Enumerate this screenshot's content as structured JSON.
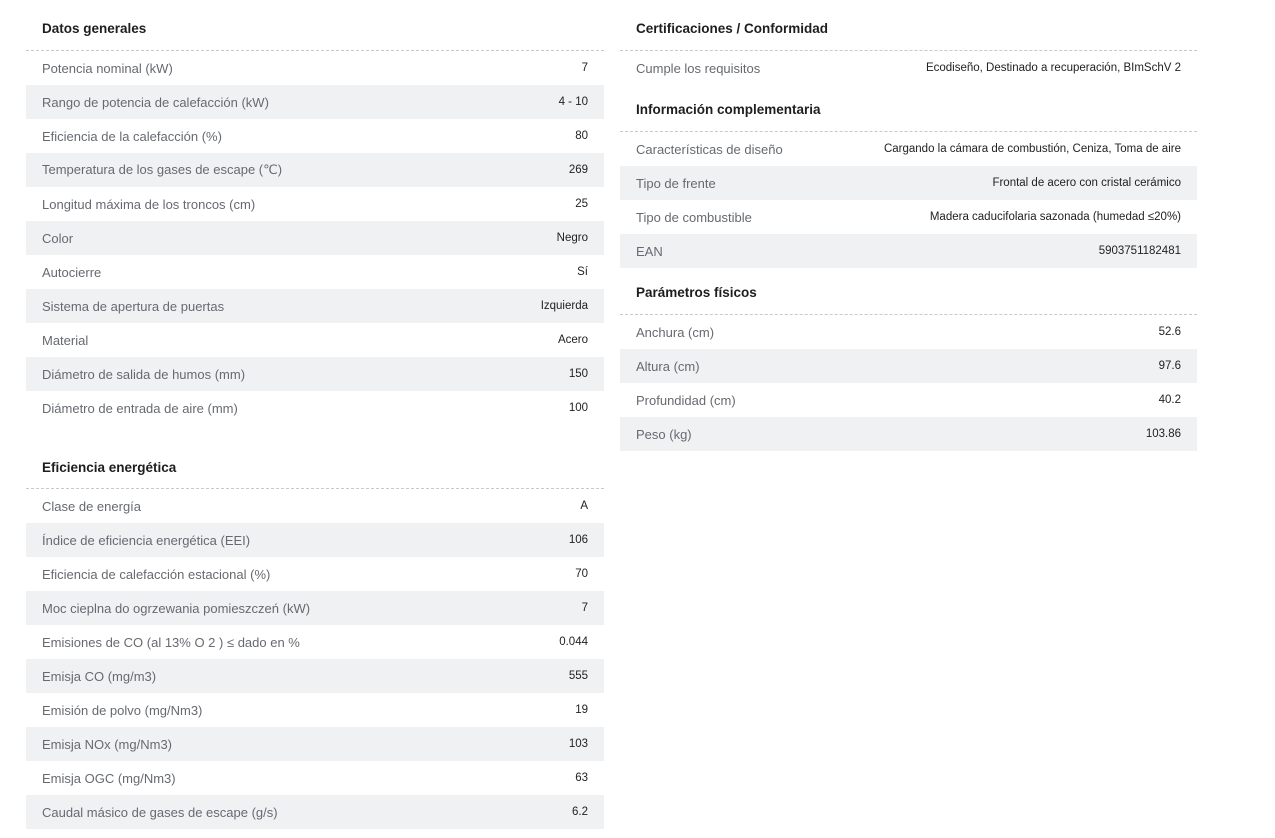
{
  "left": {
    "general": {
      "title": "Datos generales",
      "rows": [
        {
          "label": "Potencia nominal (kW)",
          "value": "7"
        },
        {
          "label": "Rango de potencia de calefacción (kW)",
          "value": "4 - 10"
        },
        {
          "label": "Eficiencia de la calefacción (%)",
          "value": "80"
        },
        {
          "label": "Temperatura de los gases de escape (℃)",
          "value": "269"
        },
        {
          "label": "Longitud máxima de los troncos (cm)",
          "value": "25"
        },
        {
          "label": "Color",
          "value": "Negro"
        },
        {
          "label": "Autocierre",
          "value": "Sí"
        },
        {
          "label": "Sistema de apertura de puertas",
          "value": "Izquierda"
        },
        {
          "label": "Material",
          "value": "Acero"
        },
        {
          "label": "Diámetro de salida de humos (mm)",
          "value": "150"
        },
        {
          "label": "Diámetro de entrada de aire (mm)",
          "value": "100"
        }
      ]
    },
    "energy": {
      "title": "Eficiencia energética",
      "rows": [
        {
          "label": "Clase de energía",
          "value": "A"
        },
        {
          "label": "Índice de eficiencia energética (EEI)",
          "value": "106"
        },
        {
          "label": "Eficiencia de calefacción estacional (%)",
          "value": "70"
        },
        {
          "label": "Moc cieplna do ogrzewania pomieszczeń (kW)",
          "value": "7"
        },
        {
          "label": "Emisiones de CO (al 13% O 2 ) ≤ dado en %",
          "value": "0.044"
        },
        {
          "label": "Emisja CO (mg/m3)",
          "value": "555"
        },
        {
          "label": "Emisión de polvo (mg/Nm3)",
          "value": "19"
        },
        {
          "label": "Emisja NOx (mg/Nm3)",
          "value": "103"
        },
        {
          "label": "Emisja OGC (mg/Nm3)",
          "value": "63"
        },
        {
          "label": "Caudal másico de gases de escape (g/s)",
          "value": "6.2"
        }
      ]
    }
  },
  "right": {
    "certifications": {
      "title": "Certificaciones / Conformidad",
      "rows": [
        {
          "label": "Cumple los requisitos",
          "value": "Ecodiseño, Destinado a recuperación, BImSchV 2"
        }
      ]
    },
    "complementary": {
      "title": "Información complementaria",
      "rows": [
        {
          "label": "Características de diseño",
          "value": "Cargando la cámara de combustión, Ceniza, Toma de aire"
        },
        {
          "label": "Tipo de frente",
          "value": "Frontal de acero con cristal cerámico"
        },
        {
          "label": "Tipo de combustible",
          "value": "Madera caducifolaria sazonada (humedad ≤20%)"
        },
        {
          "label": "EAN",
          "value": "5903751182481"
        }
      ]
    },
    "physical": {
      "title": "Parámetros físicos",
      "rows": [
        {
          "label": "Anchura (cm)",
          "value": "52.6"
        },
        {
          "label": "Altura (cm)",
          "value": "97.6"
        },
        {
          "label": "Profundidad (cm)",
          "value": "40.2"
        },
        {
          "label": "Peso (kg)",
          "value": "103.86"
        }
      ]
    }
  },
  "colors": {
    "alt_row": "#f0f1f3",
    "label": "#666a70",
    "value": "#222222",
    "title": "#1e1e1e"
  }
}
